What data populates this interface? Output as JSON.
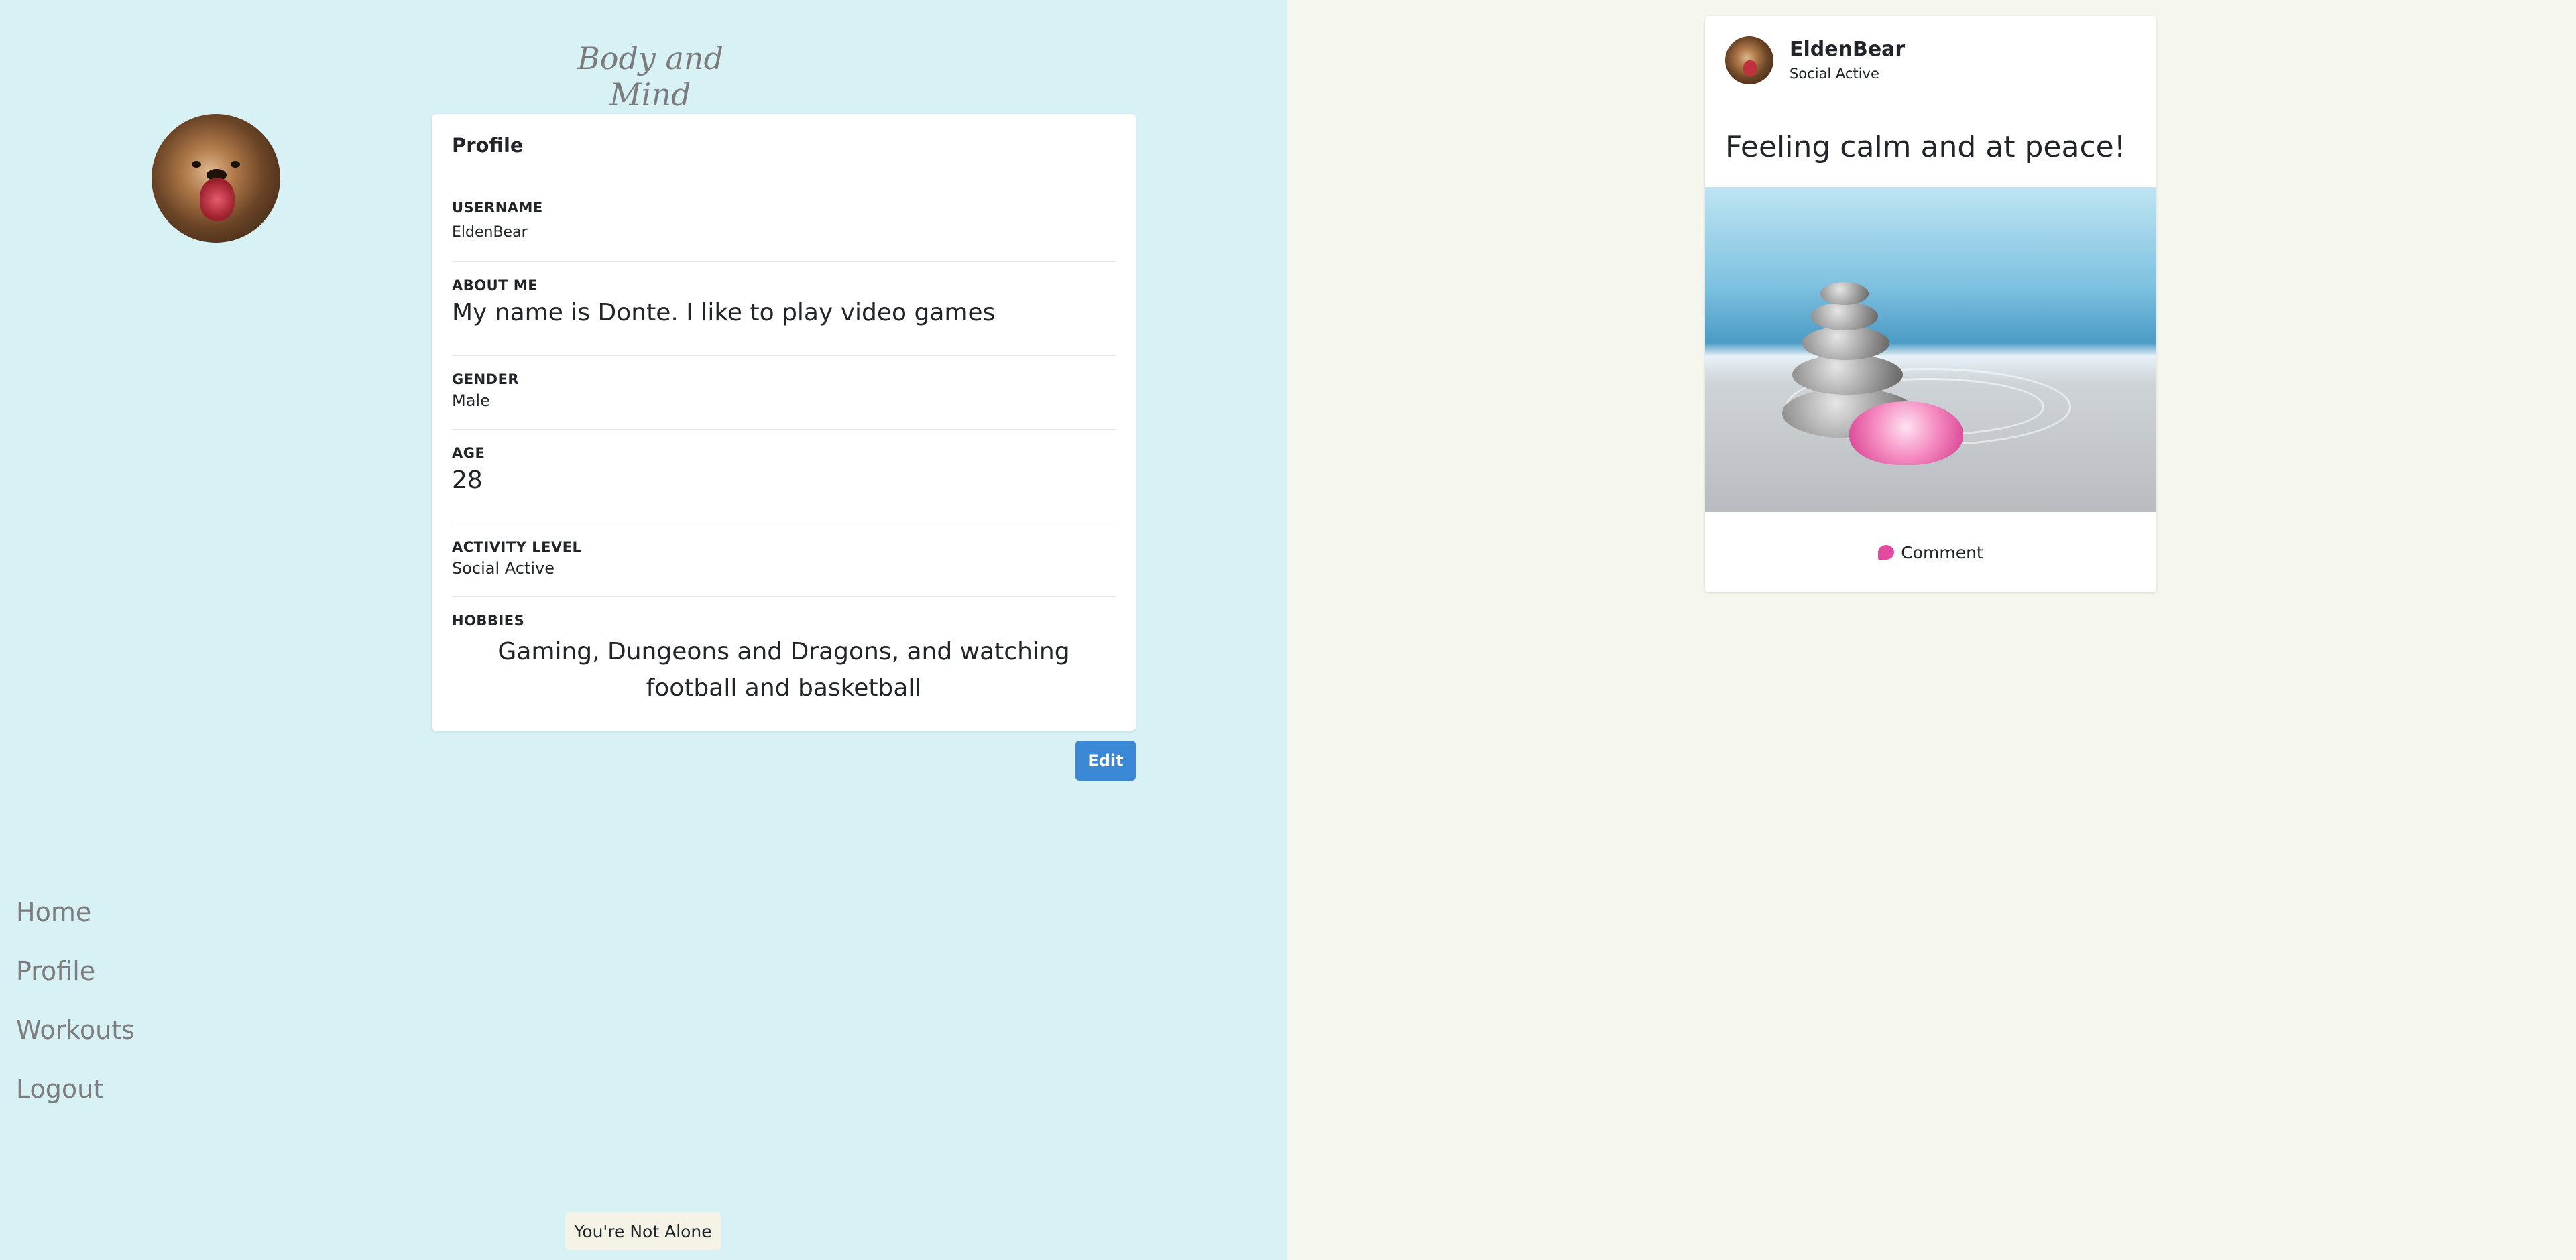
{
  "app": {
    "title": "Body and Mind"
  },
  "profile": {
    "card_title": "Profile",
    "fields": [
      {
        "label": "USERNAME",
        "value": "EldenBear"
      },
      {
        "label": "ABOUT ME",
        "value": "My name is Donte. I like to play video games"
      },
      {
        "label": "GENDER",
        "value": "Male"
      },
      {
        "label": "AGE",
        "value": "28"
      },
      {
        "label": "ACTIVITY LEVEL",
        "value": "Social Active"
      },
      {
        "label": "HOBBIES",
        "value": "Gaming, Dungeons and Dragons, and watching football and basketball"
      }
    ],
    "edit_label": "Edit"
  },
  "nav": {
    "items": [
      "Home",
      "Profile",
      "Workouts",
      "Logout"
    ]
  },
  "footer": {
    "badge": "You're Not Alone"
  },
  "post": {
    "author": "EldenBear",
    "subtitle": "Social Active",
    "text": "Feeling calm and at peace!",
    "comment_label": "Comment"
  },
  "colors": {
    "left_background": "#d8f1f5",
    "right_background": "#f5f6ee",
    "primary_button": "#3b88d4",
    "comment_icon": "#e34ba0"
  },
  "icons": {
    "avatar": "bear-avatar",
    "comment": "speech-bubble-icon"
  }
}
